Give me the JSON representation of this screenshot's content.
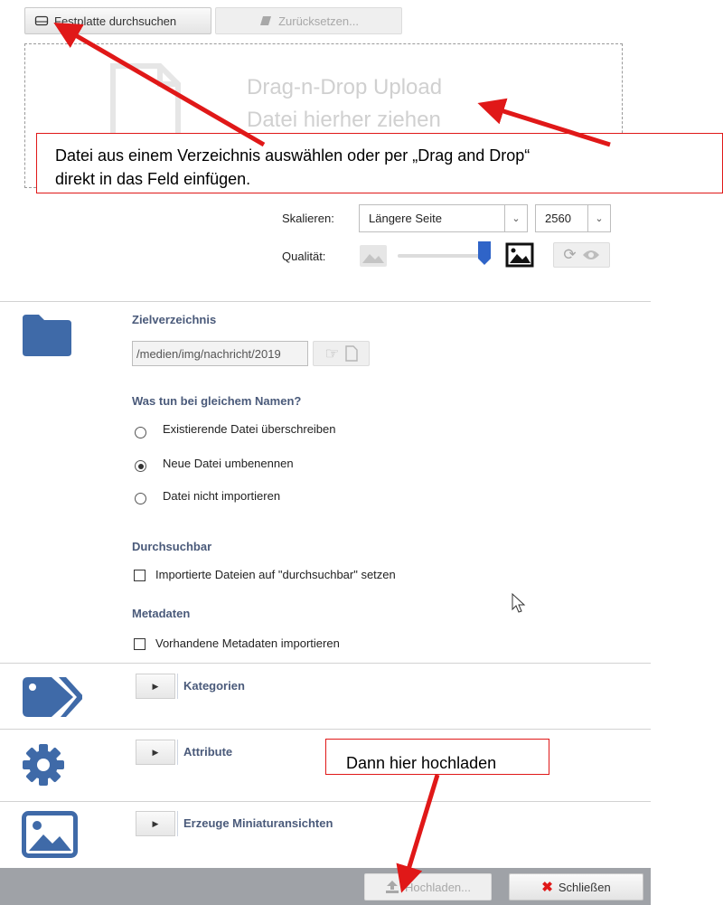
{
  "toolbar": {
    "browse_label": "Festplatte durchsuchen",
    "reset_label": "Zurücksetzen..."
  },
  "dropzone": {
    "line1": "Drag-n-Drop Upload",
    "line2": "Datei hierher ziehen"
  },
  "callouts": {
    "top_line1": "Datei aus einem Verzeichnis auswählen oder per „Drag and Drop“",
    "top_line2": "direkt in das Feld einfügen.",
    "upload_hint": "Dann hier hochladen"
  },
  "image_options": {
    "scale_label": "Skalieren:",
    "scale_mode": "Längere Seite",
    "scale_size": "2560",
    "quality_label": "Qualität:",
    "quality_level": 1.0
  },
  "target": {
    "title": "Zielverzeichnis",
    "path": "/medien/img/nachricht/2019"
  },
  "same_name": {
    "title": "Was tun bei gleichem Namen?",
    "options": [
      "Existierende Datei überschreiben",
      "Neue Datei umbenennen",
      "Datei nicht importieren"
    ],
    "selected": 1
  },
  "searchable": {
    "title": "Durchsuchbar",
    "option": "Importierte Dateien auf \"durchsuchbar\" setzen"
  },
  "metadata": {
    "title": "Metadaten",
    "option": "Vorhandene Metadaten importieren"
  },
  "sections": {
    "categories": "Kategorien",
    "attributes": "Attribute",
    "thumbnails": "Erzeuge Miniaturansichten"
  },
  "footer": {
    "upload_label": "Hochladen...",
    "close_label": "Schließen"
  },
  "colors": {
    "accent": "#3f6aa8",
    "callout_border": "#e01818",
    "footer_bg": "#9fa2a7"
  }
}
